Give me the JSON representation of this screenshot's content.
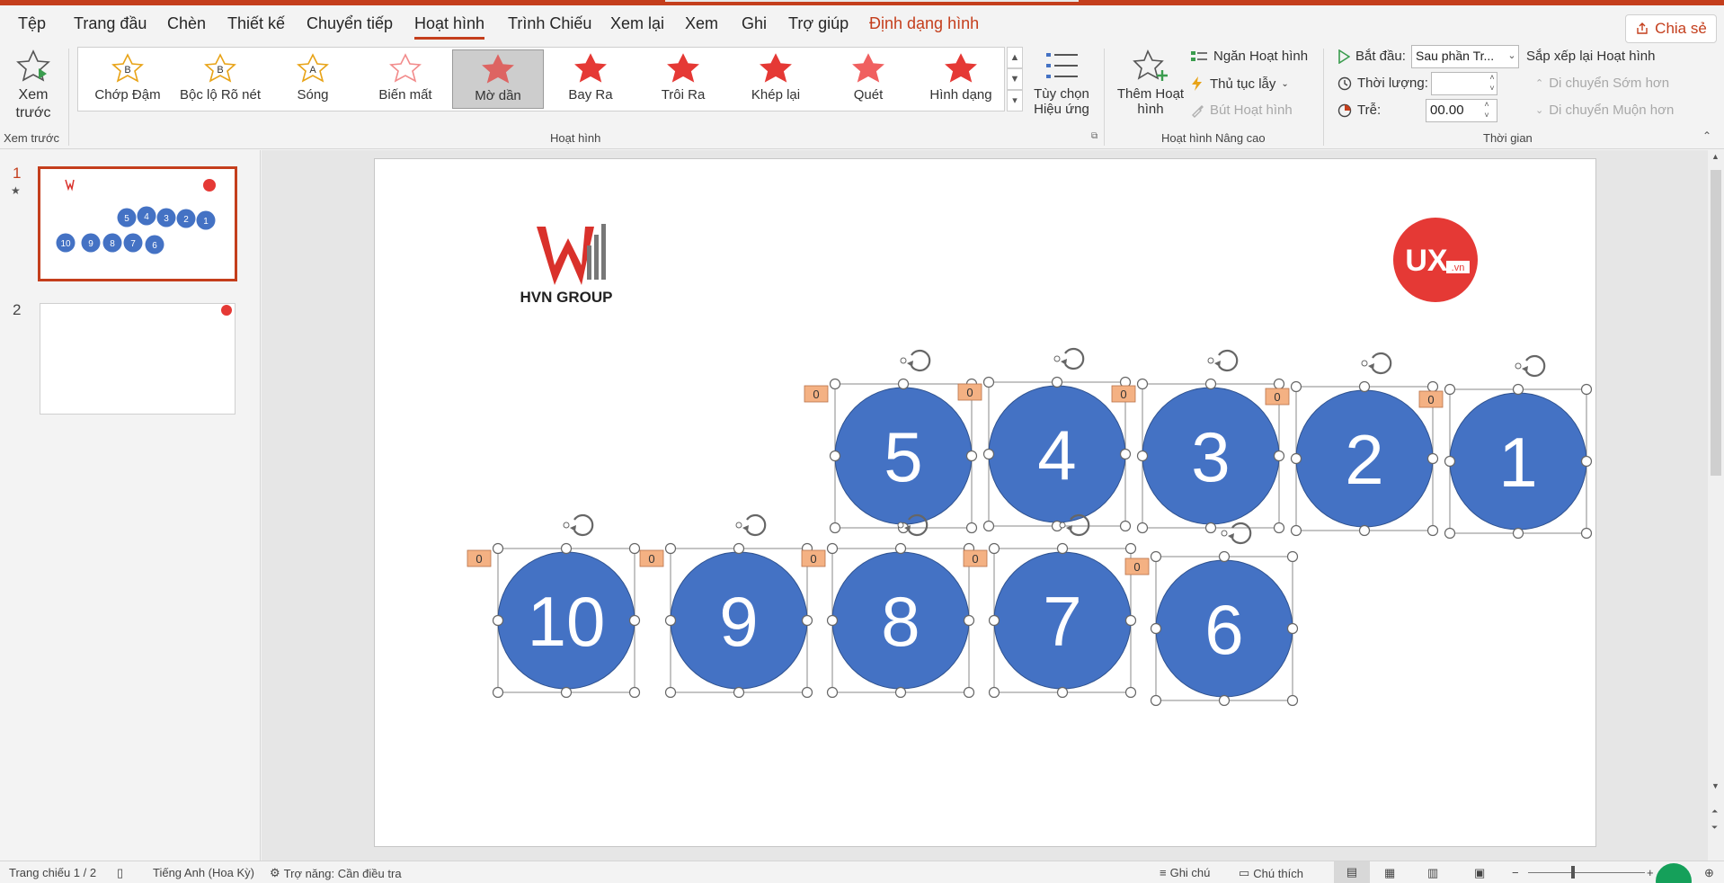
{
  "menu": {
    "tabs": [
      "Tệp",
      "Trang đầu",
      "Chèn",
      "Thiết kế",
      "Chuyển tiếp",
      "Hoạt hình",
      "Trình Chiếu",
      "Xem lại",
      "Xem",
      "Ghi",
      "Trợ giúp",
      "Định dạng hình"
    ],
    "active_tab": "Hoạt hình",
    "share": "Chia sẻ"
  },
  "ribbon": {
    "preview": {
      "label1": "Xem",
      "label2": "trước",
      "group": "Xem trước"
    },
    "animations": [
      "Chớp Đậm",
      "Bộc lộ Rõ nét",
      "Sóng",
      "Biến mất",
      "Mờ dần",
      "Bay Ra",
      "Trôi Ra",
      "Khép lại",
      "Quét",
      "Hình dạng"
    ],
    "selected_animation": "Mờ dần",
    "effect_options": {
      "line1": "Tùy chọn",
      "line2": "Hiệu ứng"
    },
    "group_animation": "Hoạt hình",
    "add_animation": {
      "line1": "Thêm Hoạt",
      "line2": "hình"
    },
    "animation_pane": "Ngăn Hoạt hình",
    "trigger": "Thủ tục lẫy",
    "painter": "Bút Hoạt hình",
    "group_advanced": "Hoạt hình Nâng cao",
    "start_label": "Bắt đầu:",
    "start_value": "Sau phần Tr...",
    "duration_label": "Thời lượng:",
    "duration_value": "",
    "delay_label": "Trễ:",
    "delay_value": "00.00",
    "reorder": "Sắp xếp lại Hoạt hình",
    "move_earlier": "Di chuyển Sớm hơn",
    "move_later": "Di chuyển Muộn hơn",
    "group_timing": "Thời gian"
  },
  "thumbnails": [
    {
      "num": "1",
      "circles": [
        "5",
        "4",
        "3",
        "2",
        "1",
        "10",
        "9",
        "8",
        "7",
        "6"
      ]
    },
    {
      "num": "2"
    }
  ],
  "slide": {
    "brand_left": "HVN GROUP",
    "brand_right": "UX",
    "brand_right_suffix": ".vn",
    "anim_order_tag": "0",
    "circles_row1": [
      "5",
      "4",
      "3",
      "2",
      "1"
    ],
    "circles_row2": [
      "10",
      "9",
      "8",
      "7",
      "6"
    ]
  },
  "status": {
    "slide_info": "Trang chiếu 1 / 2",
    "language": "Tiếng Anh (Hoa Kỳ)",
    "accessibility": "Trợ năng: Cần điều tra",
    "notes": "Ghi chú",
    "comments": "Chú thích"
  },
  "colors": {
    "accent": "#c43e1c",
    "circle_fill": "#4472c4",
    "tag_fill": "#f4b183",
    "ux_logo": "#e53935"
  },
  "icons": [
    "star-icon",
    "sparkle-star-icon",
    "effect-options-icon",
    "add-animation-icon",
    "animation-pane-icon",
    "lightning-icon",
    "paintbrush-icon",
    "play-icon",
    "clock-icon",
    "delay-icon",
    "up-arrow-icon",
    "down-arrow-icon",
    "rotate-handle-icon",
    "book-icon",
    "accessibility-icon",
    "notes-icon",
    "comment-icon",
    "normal-view-icon",
    "slide-sorter-icon",
    "reading-view-icon",
    "slideshow-icon"
  ]
}
